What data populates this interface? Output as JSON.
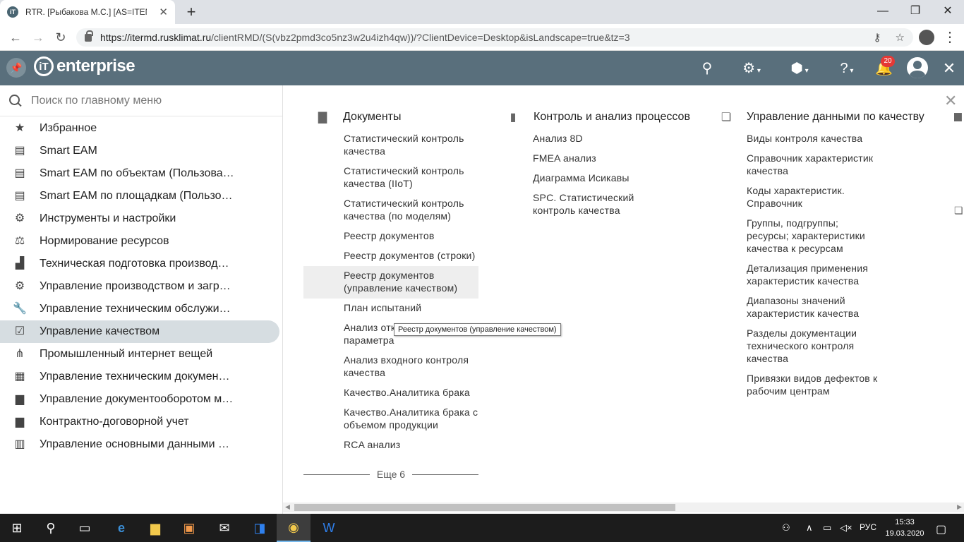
{
  "browser": {
    "tab_title": "RTR. [Рыбакова М.С.] [AS=ITENT",
    "tab_favicon": "iT",
    "url_host": "https://itermd.rusklimat.ru",
    "url_path": "/clientRMD/(S(vbz2pmd3co5nz3w2u4izh4qw))/?ClientDevice=Desktop&isLandscape=true&tz=3"
  },
  "app": {
    "logo_mark": "iT",
    "logo_text": "enterprise",
    "notifications_count": "20",
    "header_color": "#596f7c"
  },
  "sidebar": {
    "search_placeholder": "Поиск по главному меню",
    "items": [
      {
        "icon": "star-icon",
        "glyph": "★",
        "label": "Избранное"
      },
      {
        "icon": "calendar-icon",
        "glyph": "▤",
        "label": "Smart EAM"
      },
      {
        "icon": "calendar-icon",
        "glyph": "▤",
        "label": "Smart EAM по объектам (Пользова…"
      },
      {
        "icon": "calendar-icon",
        "glyph": "▤",
        "label": "Smart EAM по площадкам (Пользо…"
      },
      {
        "icon": "settings-box-icon",
        "glyph": "⚙",
        "label": "Инструменты и настройки"
      },
      {
        "icon": "scales-icon",
        "glyph": "⚖",
        "label": "Нормирование ресурсов"
      },
      {
        "icon": "factory-icon",
        "glyph": "▟",
        "label": "Техническая подготовка производ…"
      },
      {
        "icon": "gear-icon",
        "glyph": "⚙",
        "label": "Управление производством и загр…"
      },
      {
        "icon": "wrench-icon",
        "glyph": "🔧",
        "label": "Управление техническим обслужи…"
      },
      {
        "icon": "checkbox-icon",
        "glyph": "☑",
        "label": "Управление качеством",
        "active": true
      },
      {
        "icon": "network-icon",
        "glyph": "⋔",
        "label": "Промышленный интернет вещей"
      },
      {
        "icon": "document-list-icon",
        "glyph": "▦",
        "label": "Управление техническим докумен…"
      },
      {
        "icon": "file-icon",
        "glyph": "▆",
        "label": "Управление документооборотом м…"
      },
      {
        "icon": "file-icon",
        "glyph": "▆",
        "label": "Контрактно-договорной учет"
      },
      {
        "icon": "book-icon",
        "glyph": "▥",
        "label": "Управление основными данными …"
      }
    ]
  },
  "content": {
    "sections": [
      {
        "title": "Документы",
        "icon": "folder-icon",
        "links": [
          "Статистический контроль качества",
          "Статистический контроль качества (IIoT)",
          "Статистический контроль качества (по моделям)",
          "Реестр документов",
          "Реестр документов (строки)",
          "Реестр документов (управление качеством)",
          "План испытаний",
          "Анализ отклонений параметра",
          "Анализ входного контроля качества",
          "Качество.Аналитика брака",
          "Качество.Аналитика брака с объемом продукции",
          "RCA анализ"
        ],
        "more": "Еще 6"
      },
      {
        "title": "Контроль и анализ процессов",
        "icon": "chart-file-icon",
        "links": [
          "Анализ 8D",
          "FMEA анализ",
          "Диаграмма Исикавы",
          "SPC. Статистический контроль качества"
        ]
      },
      {
        "title": "Управление данными по качеству",
        "icon": "library-icon",
        "links": [
          "Виды контроля качества",
          "Справочник характеристик качества",
          "Коды характеристик. Справочник",
          "Группы, подгруппы; ресурсы; характеристики качества к ресурсам",
          "Детализация применения характеристик качества",
          "Диапазоны значений характеристик качества",
          "Разделы документации технического контроля качества",
          "Привязки видов дефектов к рабочим центрам"
        ]
      }
    ],
    "tooltip": "Реестр документов (управление качеством)"
  },
  "taskbar": {
    "language": "РУС",
    "time": "15:33",
    "date": "19.03.2020"
  }
}
